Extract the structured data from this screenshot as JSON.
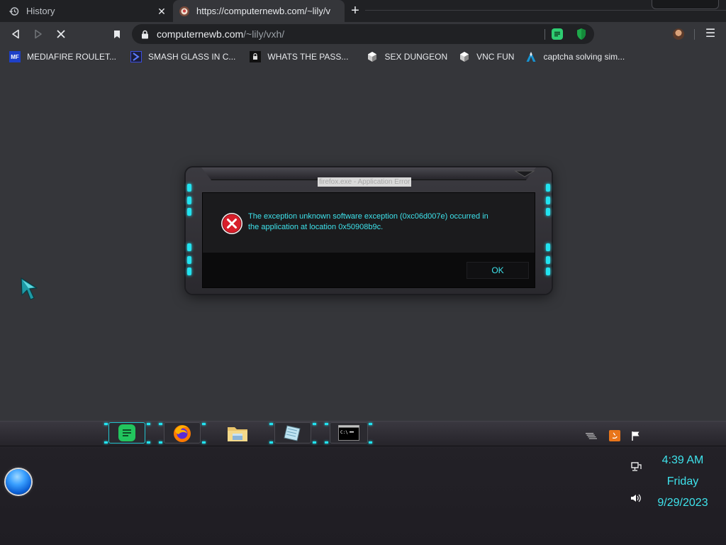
{
  "tabs": [
    {
      "title": "History",
      "icon": "history-icon",
      "active": false
    },
    {
      "title": "https://computernewb.com/~lily/v",
      "icon": "site-favicon-icon",
      "active": true
    }
  ],
  "toolbar": {
    "url_host": "computernewb.com",
    "url_path": "/~lily/vxh/"
  },
  "bookmarks": [
    {
      "label": "MEDIAFIRE ROULET...",
      "icon": "mediafire-icon"
    },
    {
      "label": "SMASH GLASS IN C...",
      "icon": "chevron-logo-icon"
    },
    {
      "label": "WHATS THE PASS...",
      "icon": "lock-badge-icon"
    },
    {
      "label": "SEX DUNGEON",
      "icon": "vm-icon"
    },
    {
      "label": "VNC FUN",
      "icon": "vm-icon"
    },
    {
      "label": "captcha solving sim...",
      "icon": "arch-logo-icon"
    }
  ],
  "dialog": {
    "title": "firefox.exe - Application Error",
    "message_line1": "The exception unknown software exception (0xc06d007e) occurred in",
    "message_line2": "the application at location 0x50908b9c.",
    "ok_label": "OK"
  },
  "taskbar": {
    "apps": [
      "chat-app-icon",
      "firefox-icon",
      "file-explorer-icon",
      "notepad-icon",
      "command-prompt-icon"
    ]
  },
  "clock": {
    "time": "4:39 AM",
    "day": "Friday",
    "date": "9/29/2023"
  },
  "colors": {
    "accent_cyan": "#3ee3ec",
    "chrome_dark": "#202124",
    "chrome_mid": "#35363a"
  }
}
